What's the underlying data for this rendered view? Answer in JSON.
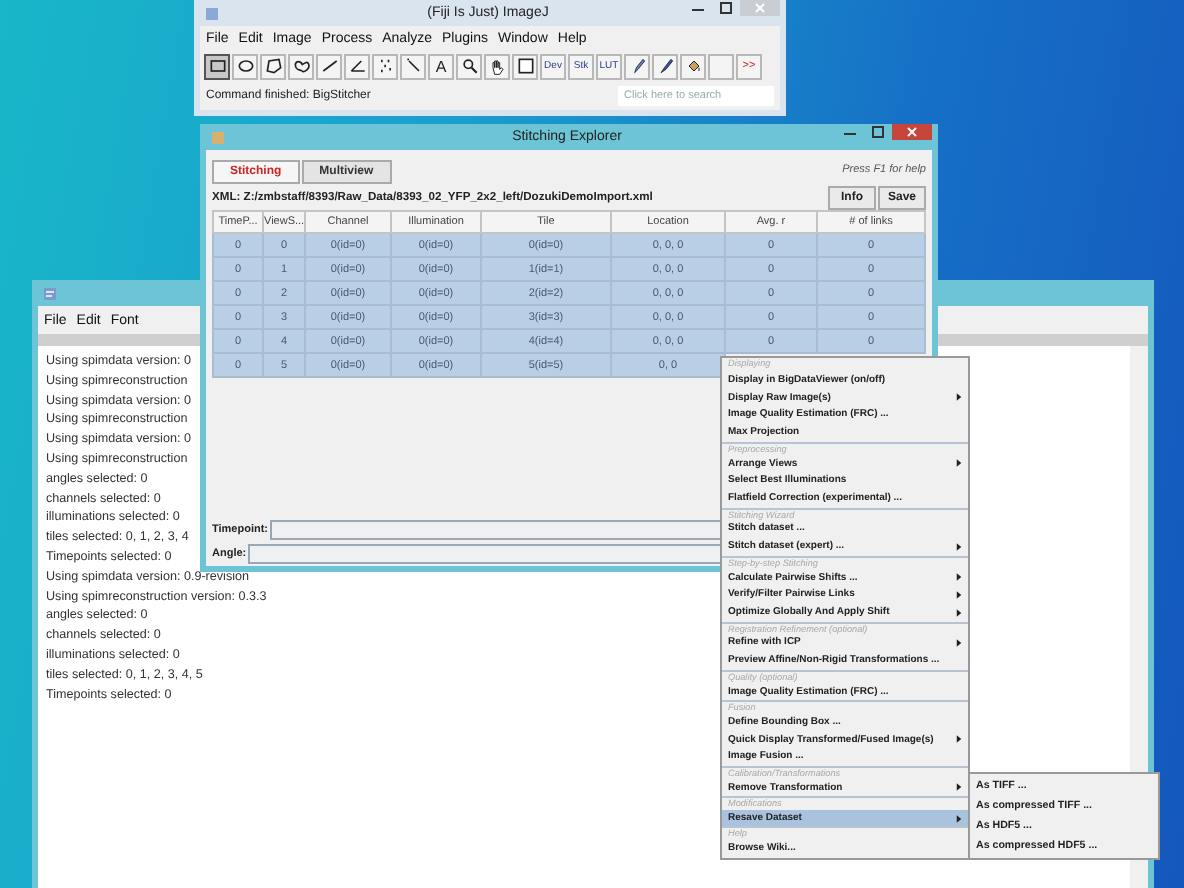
{
  "imagej": {
    "title": "(Fiji Is Just) ImageJ",
    "menus": [
      "File",
      "Edit",
      "Image",
      "Process",
      "Analyze",
      "Plugins",
      "Window",
      "Help"
    ],
    "tools": [
      {
        "kind": "rectangle",
        "selected": true
      },
      {
        "kind": "oval",
        "selected": false
      },
      {
        "kind": "polygon",
        "selected": false
      },
      {
        "kind": "freehand",
        "selected": false
      },
      {
        "kind": "line",
        "selected": false
      },
      {
        "kind": "angle",
        "selected": false
      },
      {
        "kind": "points",
        "selected": false
      },
      {
        "kind": "wand",
        "selected": false
      },
      {
        "kind": "text",
        "label": "A",
        "selected": false
      },
      {
        "kind": "magnifier",
        "selected": false
      },
      {
        "kind": "hand",
        "selected": false
      },
      {
        "kind": "picker",
        "selected": false
      },
      {
        "kind": "label",
        "label": "Dev",
        "selected": false
      },
      {
        "kind": "label",
        "label": "Stk",
        "selected": false
      },
      {
        "kind": "label",
        "label": "LUT",
        "selected": false
      },
      {
        "kind": "pencil",
        "selected": false
      },
      {
        "kind": "brush",
        "selected": false
      },
      {
        "kind": "fill",
        "selected": false
      },
      {
        "kind": "blank",
        "selected": false
      },
      {
        "kind": "more",
        "label": ">>",
        "selected": false
      }
    ],
    "status": "Command finished: BigStitcher",
    "search": {
      "placeholder": "Click here to search"
    }
  },
  "explorer": {
    "title": "Stitching Explorer",
    "tabs": [
      {
        "label": "Stitching",
        "selected": true
      },
      {
        "label": "Multiview",
        "selected": false
      }
    ],
    "help": "Press F1 for help",
    "xml": "XML: Z:/zmbstaff/8393/Raw_Data/8393_02_YFP_2x2_left/DozukiDemoImport.xml",
    "buttons": [
      "Info",
      "Save"
    ],
    "table": {
      "columns": [
        "TimeP...",
        "ViewS...",
        "Channel",
        "Illumination",
        "Tile",
        "Location",
        "Avg. r",
        "# of links"
      ],
      "rows": [
        {
          "selected": true,
          "cells": [
            "0",
            "0",
            "0(id=0)",
            "0(id=0)",
            "0(id=0)",
            "0, 0, 0",
            "0",
            "0"
          ]
        },
        {
          "selected": true,
          "cells": [
            "0",
            "1",
            "0(id=0)",
            "0(id=0)",
            "1(id=1)",
            "0, 0, 0",
            "0",
            "0"
          ]
        },
        {
          "selected": true,
          "cells": [
            "0",
            "2",
            "0(id=0)",
            "0(id=0)",
            "2(id=2)",
            "0, 0, 0",
            "0",
            "0"
          ]
        },
        {
          "selected": true,
          "cells": [
            "0",
            "3",
            "0(id=0)",
            "0(id=0)",
            "3(id=3)",
            "0, 0, 0",
            "0",
            "0"
          ]
        },
        {
          "selected": true,
          "cells": [
            "0",
            "4",
            "0(id=0)",
            "0(id=0)",
            "4(id=4)",
            "0, 0, 0",
            "0",
            "0"
          ]
        },
        {
          "selected": true,
          "cells": [
            "0",
            "5",
            "0(id=0)",
            "0(id=0)",
            "5(id=5)",
            "0, 0"
          ]
        }
      ]
    },
    "fields": [
      {
        "label": "Timepoint:"
      },
      {
        "label": "Angle:"
      }
    ]
  },
  "log": {
    "menus": [
      "File",
      "Edit",
      "Font"
    ],
    "lines": [
      "Using spimdata version: 0",
      "Using spimreconstruction",
      "Using spimdata version: 0",
      "Using spimreconstruction",
      "Using spimdata version: 0",
      "Using spimreconstruction",
      "angles selected: 0",
      "channels selected: 0",
      "illuminations selected: 0",
      "tiles selected: 0, 1, 2, 3, 4",
      "Timepoints selected: 0",
      "Using spimdata version: 0.9-revision",
      "Using spimreconstruction version: 0.3.3",
      "angles selected: 0",
      "channels selected: 0",
      "illuminations selected: 0",
      "tiles selected: 0, 1, 2, 3, 4, 5",
      "Timepoints selected: 0"
    ]
  },
  "menu": {
    "sections": [
      {
        "header": "Displaying",
        "items": [
          {
            "label": "Display in BigDataViewer (on/off)",
            "submenu": false,
            "selected": false
          },
          {
            "label": "Display Raw Image(s)",
            "submenu": true,
            "selected": false
          },
          {
            "label": "Image Quality Estimation (FRC) ...",
            "submenu": false,
            "selected": false
          },
          {
            "label": "Max Projection",
            "submenu": false,
            "selected": false
          }
        ]
      },
      {
        "header": "Preprocessing",
        "items": [
          {
            "label": "Arrange Views",
            "submenu": true,
            "selected": false
          },
          {
            "label": "Select Best Illuminations",
            "submenu": false,
            "selected": false
          },
          {
            "label": "Flatfield Correction (experimental) ...",
            "submenu": false,
            "selected": false
          }
        ]
      },
      {
        "header": "Stitching Wizard",
        "items": [
          {
            "label": "Stitch dataset ...",
            "submenu": false,
            "selected": false
          },
          {
            "label": "Stitch dataset (expert) ...",
            "submenu": true,
            "selected": false
          }
        ]
      },
      {
        "header": "Step-by-step Stitching",
        "items": [
          {
            "label": "Calculate Pairwise Shifts ...",
            "submenu": true,
            "selected": false
          },
          {
            "label": "Verify/Filter Pairwise Links",
            "submenu": true,
            "selected": false
          },
          {
            "label": "Optimize Globally And Apply Shift",
            "submenu": true,
            "selected": false
          }
        ]
      },
      {
        "header": "Registration Refinement (optional)",
        "items": [
          {
            "label": "Refine with ICP",
            "submenu": true,
            "selected": false
          },
          {
            "label": "Preview Affine/Non-Rigid Transformations ...",
            "submenu": false,
            "selected": false
          }
        ]
      },
      {
        "header": "Quality (optional)",
        "items": [
          {
            "label": "Image Quality Estimation (FRC) ...",
            "submenu": false,
            "selected": false
          }
        ]
      },
      {
        "header": "Fusion",
        "items": [
          {
            "label": "Define Bounding Box ...",
            "submenu": false,
            "selected": false
          },
          {
            "label": "Quick Display Transformed/Fused Image(s)",
            "submenu": true,
            "selected": false
          },
          {
            "label": "Image Fusion ...",
            "submenu": false,
            "selected": false
          }
        ]
      },
      {
        "header": "Calibration/Transformations",
        "items": [
          {
            "label": "Remove Transformation",
            "submenu": true,
            "selected": false
          }
        ]
      },
      {
        "header": "Modifications",
        "items": [
          {
            "label": "Resave Dataset",
            "submenu": true,
            "selected": true
          }
        ]
      },
      {
        "header": "Help",
        "items": [
          {
            "label": "Browse Wiki...",
            "submenu": false,
            "selected": false
          }
        ]
      }
    ]
  },
  "submenu": {
    "items": [
      "As TIFF ...",
      "As compressed TIFF ...",
      "As HDF5 ...",
      "As compressed HDF5 ..."
    ]
  }
}
